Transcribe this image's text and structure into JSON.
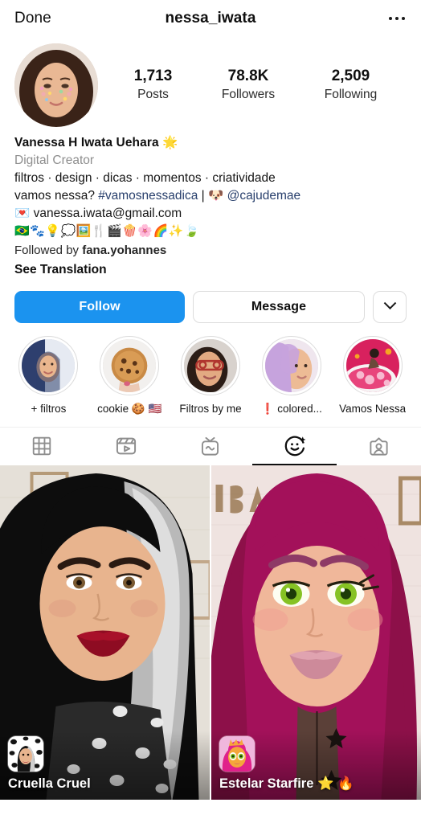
{
  "nav": {
    "done_label": "Done",
    "username": "nessa_iwata",
    "more_icon": "ellipsis-icon"
  },
  "profile": {
    "avatar_alt": "profile-photo",
    "stats": [
      {
        "value": "1,713",
        "label": "Posts"
      },
      {
        "value": "78.8K",
        "label": "Followers"
      },
      {
        "value": "2,509",
        "label": "Following"
      }
    ],
    "display_name": "Vanessa H Iwata Uehara 🌟",
    "category": "Digital Creator",
    "bio_lines": [
      "filtros · design · dicas · momentos · criatividade"
    ],
    "bio_tag_line": {
      "prefix": "vamos nessa? ",
      "hashtag": "#vamosnessadica",
      "separator": " | 🐶 ",
      "mention": "@cajudemae"
    },
    "bio_email": "💌 vanessa.iwata@gmail.com",
    "bio_emojis": "🇧🇷🐾💡💭🖼️🍴🎬🍿🌸🌈✨🍃",
    "followed_by_prefix": "Followed by ",
    "followed_by_user": "fana.yohannes",
    "see_translation": "See Translation"
  },
  "actions": {
    "follow_label": "Follow",
    "message_label": "Message",
    "more_icon": "chevron-down-icon",
    "follow_color": "#1b93ef"
  },
  "highlights": [
    {
      "label": "+ filtros",
      "icon": "highlight-filtros"
    },
    {
      "label": "cookie 🍪 🇺🇸",
      "icon": "highlight-cookie"
    },
    {
      "label": "Filtros by me",
      "icon": "highlight-filtros-by-me"
    },
    {
      "label": "❗ colored...",
      "icon": "highlight-colored"
    },
    {
      "label": "Vamos Nessa",
      "icon": "highlight-vamos-nessa"
    }
  ],
  "tabs": [
    {
      "name": "grid",
      "icon": "grid-icon",
      "active": false
    },
    {
      "name": "reels",
      "icon": "reels-icon",
      "active": false
    },
    {
      "name": "igtv",
      "icon": "igtv-icon",
      "active": false
    },
    {
      "name": "effects",
      "icon": "effects-face-icon",
      "active": true
    },
    {
      "name": "tagged",
      "icon": "tagged-person-icon",
      "active": false
    }
  ],
  "effects": [
    {
      "name": "Cruella Cruel",
      "icon": "effect-icon-cruella"
    },
    {
      "name": "Estelar Starfire ⭐ 🔥",
      "icon": "effect-icon-starfire"
    }
  ]
}
